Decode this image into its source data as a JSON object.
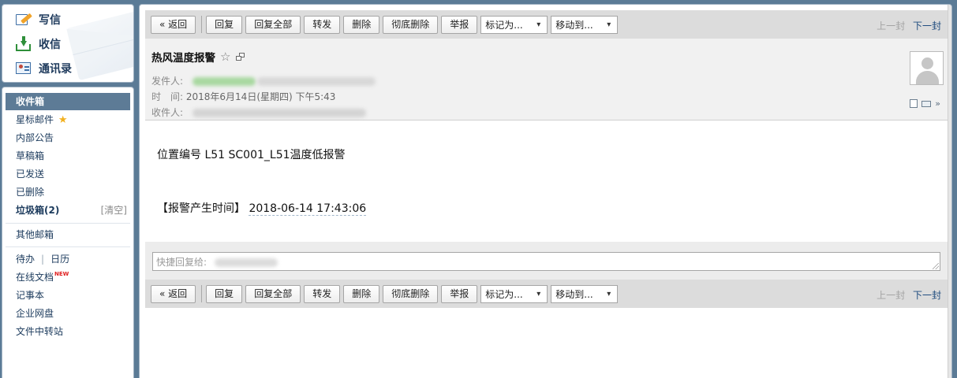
{
  "sidebar": {
    "compose_label": "写信",
    "inbox_label": "收信",
    "contacts_label": "通讯录",
    "folders": {
      "inbox": "收件箱",
      "starred": "星标邮件",
      "notices": "内部公告",
      "drafts": "草稿箱",
      "sent": "已发送",
      "deleted": "已删除",
      "spam": "垃圾箱(2)",
      "spam_clear": "[清空]",
      "other": "其他邮箱",
      "todo": "待办",
      "calendar": "日历",
      "online_docs": "在线文档",
      "online_docs_badge": "NEW",
      "notes": "记事本",
      "netdisk": "企业网盘",
      "transfer": "文件中转站"
    },
    "colors": {
      "active_bg": "#5d7b96",
      "star": "#f2b01e",
      "new_badge": "#e02020"
    }
  },
  "toolbar": {
    "back": "« 返回",
    "reply": "回复",
    "reply_all": "回复全部",
    "forward": "转发",
    "delete": "删除",
    "delete_permanent": "彻底删除",
    "report": "举报",
    "mark_as": "标记为...",
    "move_to": "移动到...",
    "prev": "上一封",
    "next": "下一封"
  },
  "mail": {
    "subject": "热风温度报警",
    "from_label": "发件人:",
    "time_label": "时　间:",
    "time_value": "2018年6月14日(星期四) 下午5:43",
    "to_label": "收件人:",
    "body_line1": "位置编号 L51 SC001_L51温度低报警",
    "body_line2_prefix": "【报警产生时间】",
    "body_line2_time": "2018-06-14 17:43:06"
  },
  "quick_reply": {
    "placeholder": "快捷回复给:"
  },
  "icons": {
    "compose": "write-icon",
    "inbox": "inbox-icon",
    "contacts": "contacts-icon",
    "star": "star-icon",
    "popout": "popout-icon",
    "note": "note-icon",
    "print": "print-icon",
    "expand": "chevron-down-icon",
    "avatar": "avatar-icon"
  }
}
